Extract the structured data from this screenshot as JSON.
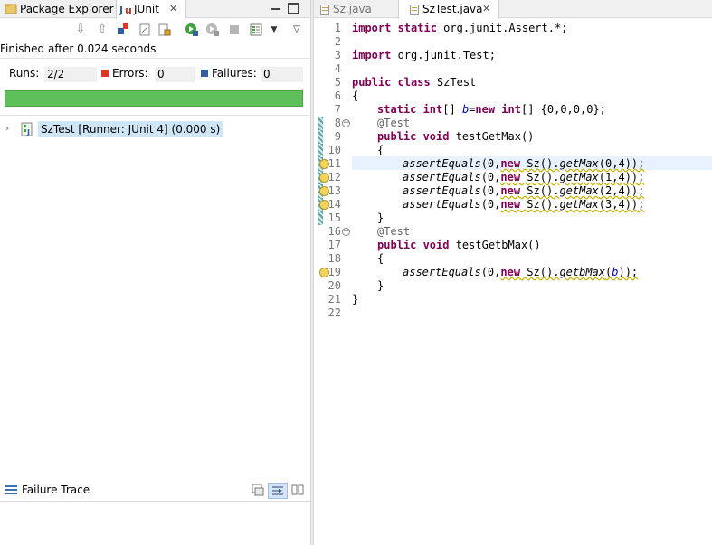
{
  "left_panel": {
    "tabs": [
      {
        "label": "Package Explorer"
      },
      {
        "label": "JUnit"
      }
    ],
    "close_glyph": "✕",
    "status": "Finished after 0.024 seconds",
    "counters": {
      "runs_label": "Runs:",
      "runs_value": "2/2",
      "errors_label": "Errors:",
      "errors_value": "0",
      "failures_label": "Failures:",
      "failures_value": "0"
    },
    "progress_fraction": 1.0,
    "progress_color": "#5fbf5a",
    "tree": {
      "label": "SzTest [Runner: JUnit 4] (0.000 s)"
    },
    "failure_trace": {
      "label": "Failure Trace"
    }
  },
  "editor": {
    "tabs": [
      {
        "label": "Sz.java"
      },
      {
        "label": "SzTest.java"
      }
    ],
    "close_glyph": "✕",
    "line_numbers": [
      "1",
      "2",
      "3",
      "4",
      "5",
      "6",
      "7",
      "8",
      "9",
      "10",
      "11",
      "12",
      "13",
      "14",
      "15",
      "16",
      "17",
      "18",
      "19",
      "20",
      "21",
      "22"
    ],
    "code": {
      "l1_kw": "import static",
      "l1_rest": " org.junit.Assert.*;",
      "l3_kw": "import",
      "l3_rest": " org.junit.Test;",
      "l5_kw": "public class",
      "l5_rest": " SzTest",
      "l6": "{",
      "l7_kw1": "static int",
      "l7_a": "[] ",
      "l7_fld": "b",
      "l7_b": "=",
      "l7_kw2": "new int",
      "l7_c": "[] {0,0,0,0};",
      "l8_ann": "@Test",
      "l9_kw": "public void",
      "l9_rest": " testGetMax()",
      "l10": "{",
      "l11_a": "assertEquals",
      "l11_b": "(0,",
      "l11_kw": "new",
      "l11_c": " Sz().",
      "l11_m": "getMax",
      "l11_d": "(0,4));",
      "l12_d": "(1,4));",
      "l13_d": "(2,4));",
      "l14_d": "(3,4));",
      "l15": "}",
      "l16_ann": "@Test",
      "l17_kw": "public void",
      "l17_rest": " testGetbMax()",
      "l18": "{",
      "l19_m": "getbMax",
      "l19_open": "(",
      "l19_fld": "b",
      "l19_close": "));",
      "l20": "}",
      "l21": "}"
    }
  },
  "colors": {
    "keyword": "#7f0055",
    "annotation": "#646464",
    "field": "#0000c0",
    "selection": "#cfe6f6",
    "current_line": "#e8f2fe"
  }
}
